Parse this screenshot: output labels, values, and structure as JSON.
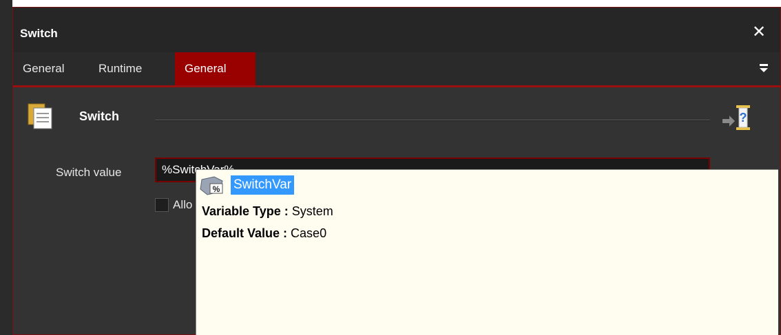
{
  "dialog": {
    "title": "Switch",
    "close_label": "✕"
  },
  "tabs": [
    {
      "label": "General"
    },
    {
      "label": "Runtime"
    },
    {
      "label": "General",
      "active": true
    }
  ],
  "header": {
    "title": "Switch",
    "icon": "copy-icon",
    "help_icon": "help-icon"
  },
  "form": {
    "switch_value_label": "Switch value",
    "switch_value": "%SwitchVar%",
    "checkbox_label_partial": "Allo"
  },
  "autocomplete": {
    "icon": "variable-icon",
    "selected_item": "SwitchVar",
    "type_label": "Variable Type :",
    "type_value": "System",
    "default_label": "Default Value :",
    "default_value": "Case0"
  },
  "colors": {
    "accent": "#990000",
    "selection": "#3399ff",
    "popup_bg": "#fffcf0"
  }
}
